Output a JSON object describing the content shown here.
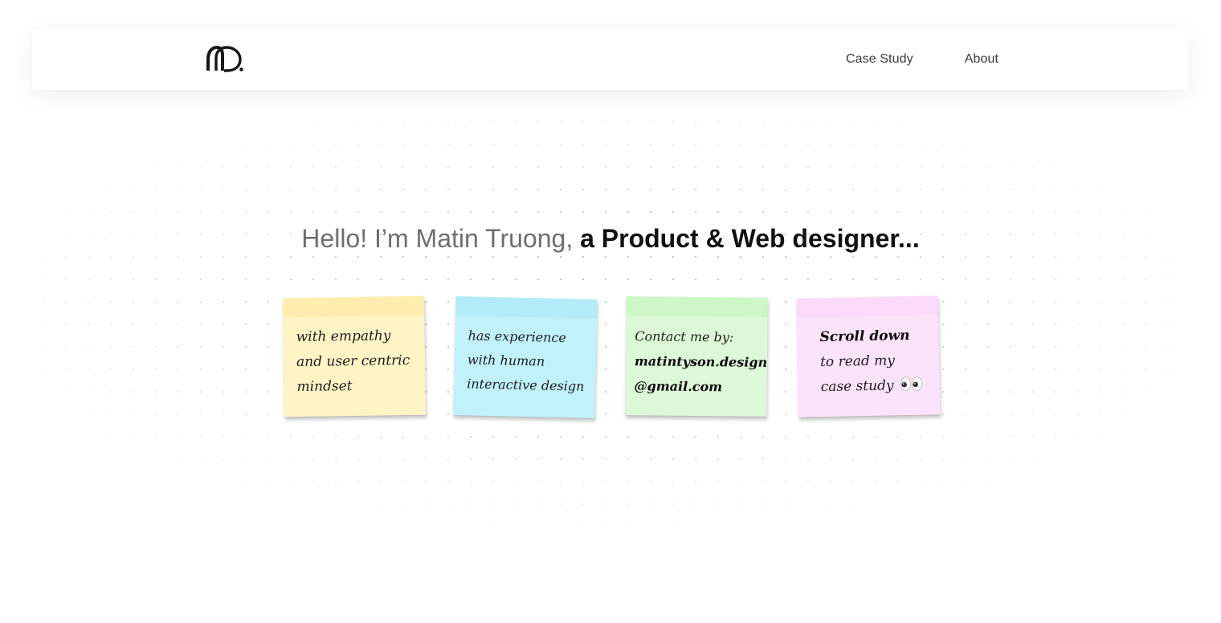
{
  "header": {
    "logo_text": "m.",
    "nav": [
      {
        "label": "Case Study"
      },
      {
        "label": "About"
      }
    ]
  },
  "hero": {
    "intro": "Hello! I’m Matin Truong,",
    "role": "a Product & Web designer..."
  },
  "notes": [
    {
      "color": "#fff4c6",
      "lines": [
        "with empathy",
        "and user centric",
        "mindset"
      ]
    },
    {
      "color": "#c1f1fb",
      "lines": [
        "has experience",
        "with human",
        "interactive design"
      ]
    },
    {
      "color": "#ddf8d8",
      "lines": [
        "Contact me by:",
        "matintyson.design",
        "@gmail.com"
      ]
    },
    {
      "color": "#fce3fb",
      "lines": [
        "Scroll down",
        "to read my",
        "case study"
      ],
      "icon": "eyes-emoji-icon"
    }
  ]
}
